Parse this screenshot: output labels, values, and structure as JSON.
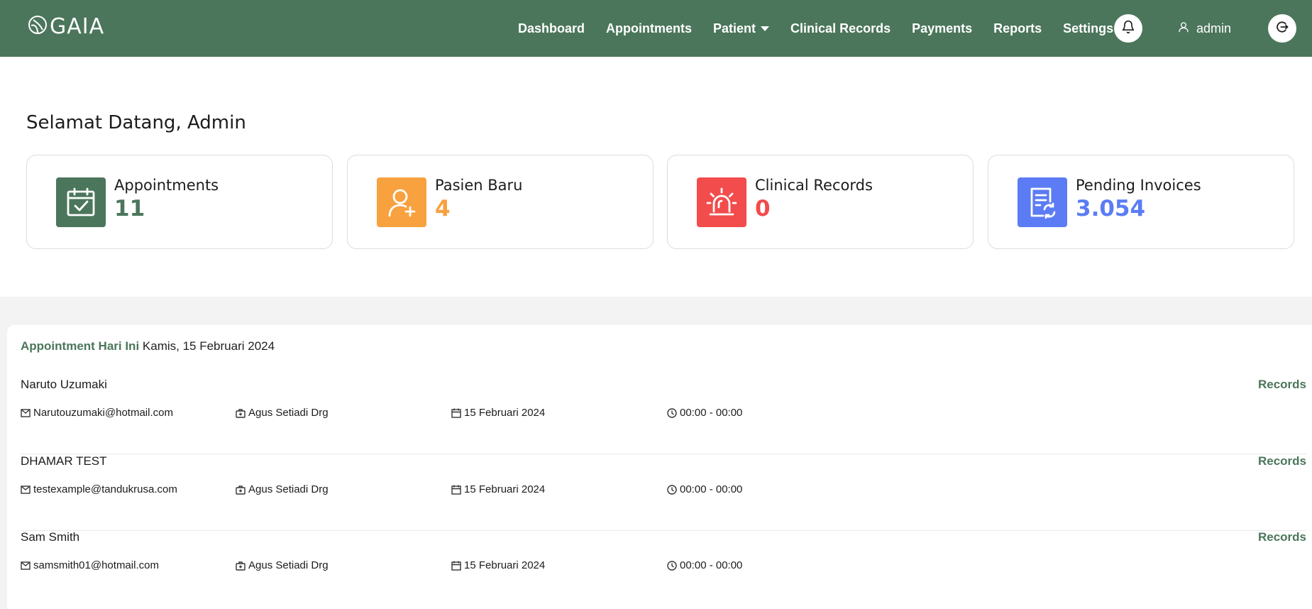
{
  "brand": {
    "name": "GAIA"
  },
  "nav": {
    "items": [
      {
        "label": "Dashboard"
      },
      {
        "label": "Appointments"
      },
      {
        "label": "Patient"
      },
      {
        "label": "Clinical Records"
      },
      {
        "label": "Payments"
      },
      {
        "label": "Reports"
      },
      {
        "label": "Settings"
      }
    ],
    "user": "admin"
  },
  "welcome": {
    "title": "Selamat Datang, Admin"
  },
  "stats": [
    {
      "label": "Appointments",
      "value": "11",
      "color": "#4b765b",
      "icon": "calendar-check-icon"
    },
    {
      "label": "Pasien Baru",
      "value": "4",
      "color": "#f8a13f",
      "icon": "user-plus-icon"
    },
    {
      "label": "Clinical Records",
      "value": "0",
      "color": "#f24c4c",
      "icon": "siren-icon"
    },
    {
      "label": "Pending Invoices",
      "value": "3.054",
      "color": "#5b7cf4",
      "icon": "invoice-refresh-icon"
    }
  ],
  "appointments": {
    "title": "Appointment Hari Ini",
    "date": "Kamis, 15 Februari 2024",
    "records_label": "Records",
    "rows": [
      {
        "name": "Naruto Uzumaki",
        "email": "Narutouzumaki@hotmail.com",
        "doctor": "Agus Setiadi Drg",
        "date": "15 Februari 2024",
        "time": "00:00 - 00:00"
      },
      {
        "name": "DHAMAR TEST",
        "email": "testexample@tandukrusa.com",
        "doctor": "Agus Setiadi Drg",
        "date": "15 Februari 2024",
        "time": "00:00 - 00:00"
      },
      {
        "name": "Sam Smith",
        "email": "samsmith01@hotmail.com",
        "doctor": "Agus Setiadi Drg",
        "date": "15 Februari 2024",
        "time": "00:00 - 00:00"
      }
    ]
  }
}
